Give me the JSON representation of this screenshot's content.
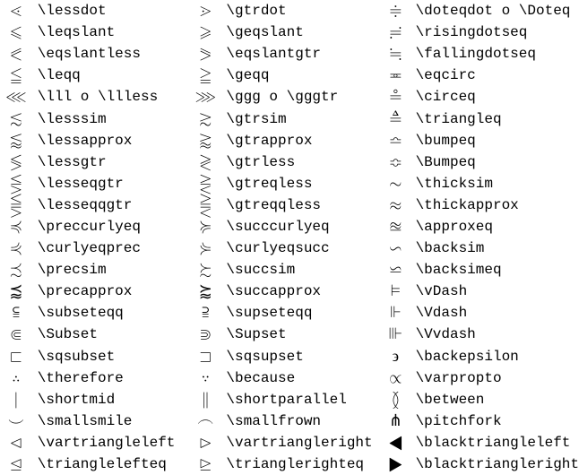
{
  "rows": [
    {
      "s1": "⋖",
      "c1": "\\lessdot",
      "s2": "⋗",
      "c2": "\\gtrdot",
      "s3": "≑",
      "c3": "\\doteqdot o \\Doteq"
    },
    {
      "s1": "⩽",
      "c1": "\\leqslant",
      "s2": "⩾",
      "c2": "\\geqslant",
      "s3": "≓",
      "c3": "\\risingdotseq"
    },
    {
      "s1": "⪕",
      "c1": "\\eqslantless",
      "s2": "⪖",
      "c2": "\\eqslantgtr",
      "s3": "≒",
      "c3": "\\fallingdotseq"
    },
    {
      "s1": "≦",
      "c1": "\\leqq",
      "s2": "≧",
      "c2": "\\geqq",
      "s3": "≖",
      "c3": "\\eqcirc"
    },
    {
      "s1": "⋘",
      "c1": "\\lll o \\llless",
      "s2": "⋙",
      "c2": "\\ggg o \\gggtr",
      "s3": "≗",
      "c3": "\\circeq"
    },
    {
      "s1": "≲",
      "c1": "\\lesssim",
      "s2": "≳",
      "c2": "\\gtrsim",
      "s3": "≜",
      "c3": "\\triangleq"
    },
    {
      "s1": "⪅",
      "c1": "\\lessapprox",
      "s2": "⪆",
      "c2": "\\gtrapprox",
      "s3": "≏",
      "c3": "\\bumpeq"
    },
    {
      "s1": "≶",
      "c1": "\\lessgtr",
      "s2": "≷",
      "c2": "\\gtrless",
      "s3": "≎",
      "c3": "\\Bumpeq"
    },
    {
      "s1": "⋚",
      "c1": "\\lesseqgtr",
      "s2": "⋛",
      "c2": "\\gtreqless",
      "s3": "∼",
      "c3": "\\thicksim"
    },
    {
      "s1": "⪋",
      "c1": "\\lesseqqgtr",
      "s2": "⪌",
      "c2": "\\gtreqqless",
      "s3": "≈",
      "c3": "\\thickapprox"
    },
    {
      "s1": "≼",
      "c1": "\\preccurlyeq",
      "s2": "≽",
      "c2": "\\succcurlyeq",
      "s3": "≊",
      "c3": "\\approxeq"
    },
    {
      "s1": "⋞",
      "c1": "\\curlyeqprec",
      "s2": "⋟",
      "c2": "\\curlyeqsucc",
      "s3": "∽",
      "c3": "\\backsim"
    },
    {
      "s1": "≾",
      "c1": "\\precsim",
      "s2": "≿",
      "c2": "\\succsim",
      "s3": "⋍",
      "c3": "\\backsimeq"
    },
    {
      "s1": "⪷",
      "c1": "\\precapprox",
      "s2": "⪸",
      "c2": "\\succapprox",
      "s3": "⊨",
      "c3": "\\vDash"
    },
    {
      "s1": "⫅",
      "c1": "\\subseteqq",
      "s2": "⫆",
      "c2": "\\supseteqq",
      "s3": "⊩",
      "c3": "\\Vdash"
    },
    {
      "s1": "⋐",
      "c1": "\\Subset",
      "s2": "⋑",
      "c2": "\\Supset",
      "s3": "⊪",
      "c3": "\\Vvdash"
    },
    {
      "s1": "⊏",
      "c1": "\\sqsubset",
      "s2": "⊐",
      "c2": "\\sqsupset",
      "s3": "϶",
      "c3": "\\backepsilon"
    },
    {
      "s1": "∴",
      "c1": "\\therefore",
      "s2": "∵",
      "c2": "\\because",
      "s3": "∝",
      "c3": "\\varpropto"
    },
    {
      "s1": "∣",
      "c1": "\\shortmid",
      "s2": "∥",
      "c2": "\\shortparallel",
      "s3": "≬",
      "c3": "\\between"
    },
    {
      "s1": "⌣",
      "c1": "\\smallsmile",
      "s2": "⌢",
      "c2": "\\smallfrown",
      "s3": "⋔",
      "c3": "\\pitchfork"
    },
    {
      "s1": "⊲",
      "c1": "\\vartriangleleft",
      "s2": "⊳",
      "c2": "\\vartriangleright",
      "s3": "◀",
      "c3": "\\blacktriangleleft"
    },
    {
      "s1": "⊴",
      "c1": "\\trianglelefteq",
      "s2": "⊵",
      "c2": "\\trianglerighteq",
      "s3": "▶",
      "c3": "\\blacktriangleright"
    }
  ]
}
